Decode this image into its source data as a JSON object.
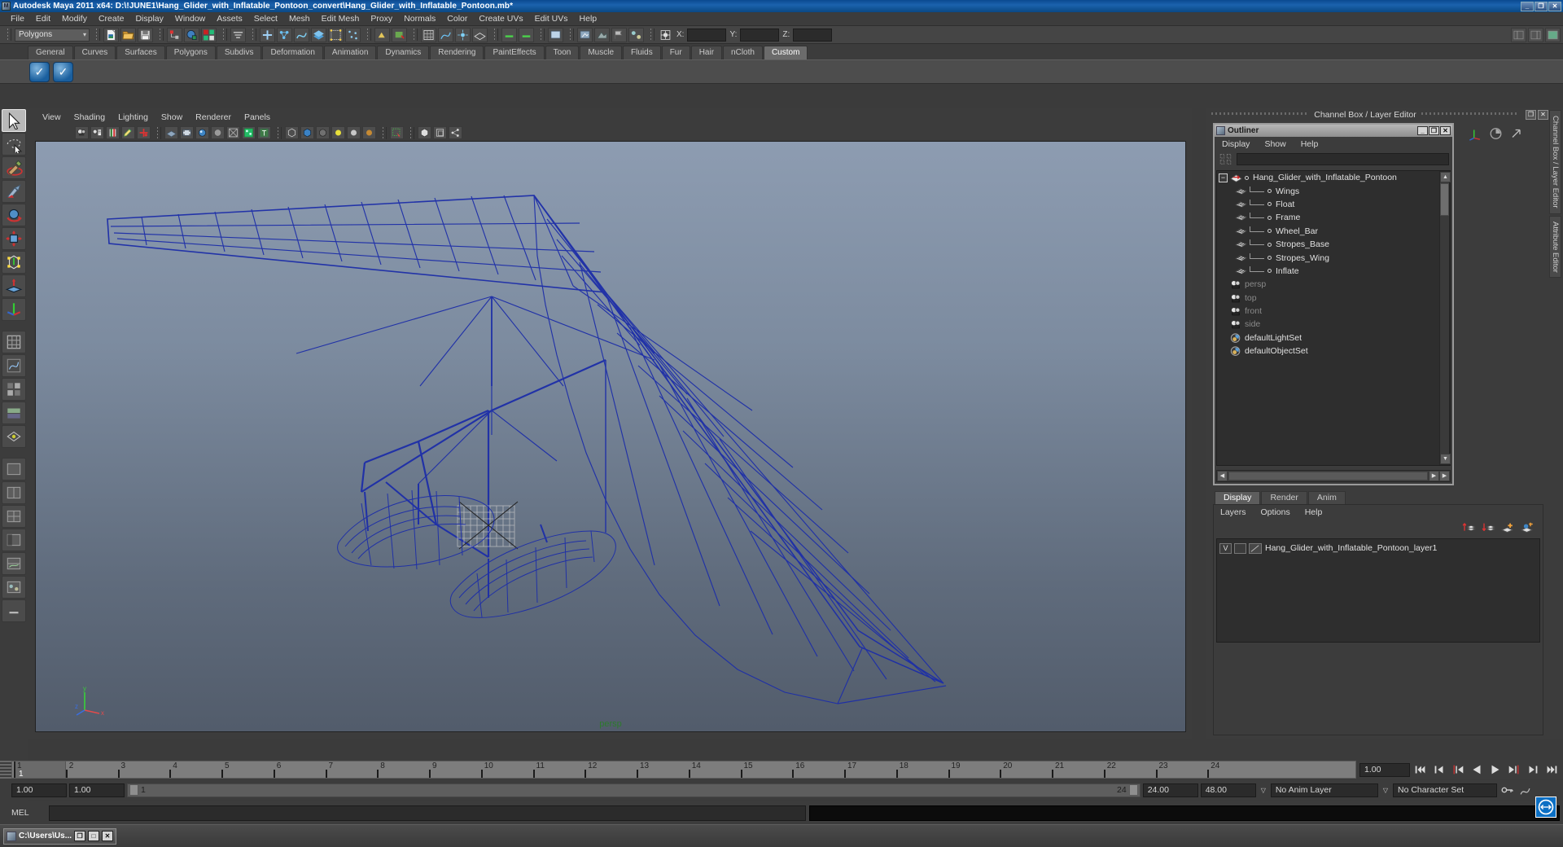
{
  "window": {
    "title": "Autodesk Maya 2011 x64: D:\\!JUNE1\\Hang_Glider_with_Inflatable_Pontoon_convert\\Hang_Glider_with_Inflatable_Pontoon.mb*",
    "minimize": "_",
    "maximize": "❐",
    "close": "✕"
  },
  "menubar": {
    "items": [
      "File",
      "Edit",
      "Modify",
      "Create",
      "Display",
      "Window",
      "Assets",
      "Select",
      "Mesh",
      "Edit Mesh",
      "Proxy",
      "Normals",
      "Color",
      "Create UVs",
      "Edit UVs",
      "Help"
    ]
  },
  "statusline": {
    "mode_selector": "Polygons",
    "axis_x_label": "X:",
    "axis_y_label": "Y:",
    "axis_z_label": "Z:",
    "axis_x_value": "",
    "axis_y_value": "",
    "axis_z_value": ""
  },
  "shelf": {
    "tabs": [
      "General",
      "Curves",
      "Surfaces",
      "Polygons",
      "Subdivs",
      "Deformation",
      "Animation",
      "Dynamics",
      "Rendering",
      "PaintEffects",
      "Toon",
      "Muscle",
      "Fluids",
      "Fur",
      "Hair",
      "nCloth",
      "Custom"
    ],
    "active_tab": "Custom",
    "buttons": [
      "check-shelf-item-1",
      "check-shelf-item-2"
    ]
  },
  "toolbox": {
    "items": [
      "select-tool",
      "lasso-select-tool",
      "paint-select-tool",
      "move-tool",
      "rotate-tool",
      "scale-tool",
      "universal-manipulator",
      "soft-modification-tool",
      "last-tool-used",
      "snap-grid",
      "snap-curve",
      "snap-point",
      "snap-view-plane",
      "make-live",
      "layout-single",
      "layout-two-pane",
      "layout-four-pane",
      "layout-persp-outliner",
      "layout-persp-graph",
      "layout-hypershade",
      "restore-layout"
    ],
    "selected": "select-tool"
  },
  "viewport": {
    "menu": [
      "View",
      "Shading",
      "Lighting",
      "Show",
      "Renderer",
      "Panels"
    ],
    "camera_label": "persp",
    "axis_labels": {
      "x": "x",
      "y": "y",
      "z": "z"
    },
    "icons": [
      "select-camera-icon",
      "camera-attributes-icon",
      "book-icon",
      "paint-icon",
      "move-keys-icon",
      "smooth-shade-icon",
      "film-gate-icon",
      "texture-icon",
      "lighting-icon",
      "xray-icon",
      "wireframe-on-shaded-icon",
      "text-icon",
      "shaded-cube-icon",
      "blue-ball-icon",
      "checker-ball-icon",
      "yellow-light-icon",
      "grey-light-icon",
      "bronze-light-icon",
      "select-marquee-icon",
      "isolate-cube-icon",
      "panel-cube-icon",
      "share-icon"
    ]
  },
  "dock": {
    "title": "Channel Box / Layer Editor",
    "restore_btn": "❐",
    "close_btn": "✕",
    "vertical_tabs": [
      "Channel Box / Layer Editor",
      "Attribute Editor"
    ]
  },
  "outliner": {
    "title": "Outliner",
    "minimize": "_",
    "maximize": "❐",
    "close": "✕",
    "menu": [
      "Display",
      "Show",
      "Help"
    ],
    "search_value": "",
    "tree": [
      {
        "label": "Hang_Glider_with_Inflatable_Pontoon",
        "icon": "transform-icon",
        "level": 0,
        "expanded": true,
        "dim": false
      },
      {
        "label": "Wings",
        "icon": "mesh-icon",
        "level": 1,
        "dim": false
      },
      {
        "label": "Float",
        "icon": "mesh-icon",
        "level": 1,
        "dim": false
      },
      {
        "label": "Frame",
        "icon": "mesh-icon",
        "level": 1,
        "dim": false
      },
      {
        "label": "Wheel_Bar",
        "icon": "mesh-icon",
        "level": 1,
        "dim": false
      },
      {
        "label": "Stropes_Base",
        "icon": "mesh-icon",
        "level": 1,
        "dim": false
      },
      {
        "label": "Stropes_Wing",
        "icon": "mesh-icon",
        "level": 1,
        "dim": false
      },
      {
        "label": "Inflate",
        "icon": "mesh-icon",
        "level": 1,
        "dim": false
      },
      {
        "label": "persp",
        "icon": "camera-icon",
        "level": 0,
        "dim": true
      },
      {
        "label": "top",
        "icon": "camera-icon",
        "level": 0,
        "dim": true
      },
      {
        "label": "front",
        "icon": "camera-icon",
        "level": 0,
        "dim": true
      },
      {
        "label": "side",
        "icon": "camera-icon",
        "level": 0,
        "dim": true
      },
      {
        "label": "defaultLightSet",
        "icon": "set-icon",
        "level": 0,
        "dim": false
      },
      {
        "label": "defaultObjectSet",
        "icon": "set-icon",
        "level": 0,
        "dim": false
      }
    ]
  },
  "layer_editor": {
    "tabs": [
      "Display",
      "Render",
      "Anim"
    ],
    "active_tab": "Display",
    "menu": [
      "Layers",
      "Options",
      "Help"
    ],
    "tool_icons": [
      "move-layer-up-icon",
      "move-layer-down-icon",
      "new-layer-icon",
      "new-layer-from-selected-icon"
    ],
    "layers": [
      {
        "visibility": "V",
        "playback": "",
        "name": "Hang_Glider_with_Inflatable_Pontoon_layer1"
      }
    ]
  },
  "timeline": {
    "ticks": [
      1,
      2,
      3,
      4,
      5,
      6,
      7,
      8,
      9,
      10,
      11,
      12,
      13,
      14,
      15,
      16,
      17,
      18,
      19,
      20,
      21,
      22,
      23,
      24
    ],
    "current_frame": "1",
    "current_frame_field": "1.00",
    "playback_buttons": [
      "go-to-start",
      "step-back-key",
      "step-back-frame",
      "play-backwards",
      "play-forwards",
      "step-forward-frame",
      "step-forward-key",
      "go-to-end"
    ]
  },
  "range": {
    "start": "1.00",
    "end": "1.00",
    "range_start_label": "1",
    "range_end_label": "24",
    "playback_start": "24.00",
    "playback_end": "48.00",
    "anim_layer": "No Anim Layer",
    "character_set": "No Character Set"
  },
  "commandline": {
    "label": "MEL",
    "value": "",
    "output": ""
  },
  "taskbar": {
    "item_label": "C:\\Users\\Us...",
    "restore": "❐",
    "maximize": "□",
    "close": "✕"
  },
  "colors": {
    "title_blue": "#0b4a8f",
    "panel_grey": "#3c3c3c",
    "wire_blue": "#1d2ea8",
    "viewport_top": "#8d9cb1",
    "viewport_bottom": "#525c6b",
    "persp_green": "#2d7a2d",
    "shelf_active": "#6b6b6b"
  }
}
